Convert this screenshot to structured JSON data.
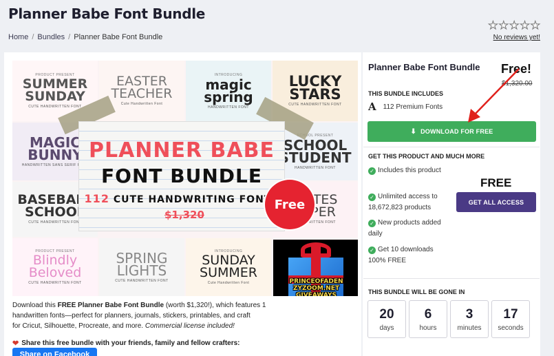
{
  "page": {
    "title": "Planner Babe Font Bundle",
    "breadcrumb": [
      "Home",
      "Bundles",
      "Planner Babe Font Bundle"
    ],
    "rating": {
      "stars": 0,
      "max_stars": 5,
      "no_reviews_text": "No reviews yet!"
    }
  },
  "product_image": {
    "tiles": [
      {
        "top": "PRODUCT PRESENT",
        "main": "SUMMER SUNDAY",
        "sub": "CUTE HANDWRITTEN FONT",
        "color": "#555555"
      },
      {
        "top": "",
        "main": "EASTER TEACHER",
        "sub": "Cute Handwritten Font",
        "color": "#666666"
      },
      {
        "top": "INTRODUCING",
        "main": "magic spring",
        "sub": "HANDWRITTEN FONT",
        "color": "#222222"
      },
      {
        "top": "",
        "main": "LUCKY STARS",
        "sub": "CUTE HANDWRITTEN FONT",
        "color": "#222222"
      },
      {
        "top": "",
        "main": "MAGIC BUNNY",
        "sub": "HANDWRITTEN SANS SERIF FONT",
        "color": "#5b4a6e"
      },
      {
        "top": "SCHOOL PRESENT",
        "main": "SCHOOL STUDENT",
        "sub": "HANDWRITTEN FONT",
        "color": "#333333"
      },
      {
        "top": "",
        "main": "BASEBALL SCHOOL",
        "sub": "CUTE HANDWRITTEN FONT",
        "color": "#333333"
      },
      {
        "top": "",
        "main": "NOTES PAPER",
        "sub": "HANDWRITTEN FONT",
        "color": "#444444"
      },
      {
        "top": "PRODUCT PRESENT",
        "main": "Blindly Beloved",
        "sub": "CUTE HANDWRITTEN FONT",
        "color": "#e58cc8"
      },
      {
        "top": "",
        "main": "SPRING LIGHTS",
        "sub": "CUTE HANDWRITTEN FONT",
        "color": "#888888"
      },
      {
        "top": "INTRODUCING",
        "main": "SUNDAY SUMMER",
        "sub": "Cute Handwritten Font",
        "color": "#222222"
      }
    ],
    "hero_title": "PLANNER BABE",
    "hero_subtitle": "FONT BUNDLE",
    "hero_count": "112",
    "hero_count_text": "CUTE HANDWRITING FONTS",
    "hero_price": "$1,320",
    "free_badge": "Free",
    "gift_text": "PRINCEOFADEN ZYZOOM.NET GIVEAWAYS"
  },
  "description": {
    "intro": "Download this ",
    "bold_name": "FREE Planner Babe Font Bundle",
    "rest": " (worth $1,320!), which features 1",
    "line2": "handwritten fonts—perfect for planners, journals, stickers, printables, and craft",
    "line3": "for Cricut, Silhouette, Procreate, and more. ",
    "license": "Commercial license included!",
    "share_text": "Share this free bundle with your friends, family and fellow crafters:",
    "share_button": "Share on Facebook"
  },
  "sidebar": {
    "title": "Planner Babe Font Bundle",
    "overlay_free": "Free!",
    "old_price": "$1,320.00",
    "includes_heading": "THIS BUNDLE INCLUDES",
    "includes_icon": "A",
    "includes_text": "112 Premium Fonts",
    "download_button": "DOWNLOAD FOR FREE",
    "more_heading": "GET THIS PRODUCT AND MUCH MORE",
    "features": [
      "Includes this product",
      "Unlimited access to 18,672,823 products",
      "New products added daily",
      "Get 10 downloads 100% FREE"
    ],
    "access_price": "FREE",
    "access_button": "GET ALL ACCESS",
    "gone_heading": "THIS BUNDLE WILL BE GONE IN",
    "countdown": [
      {
        "value": "20",
        "label": "days"
      },
      {
        "value": "6",
        "label": "hours"
      },
      {
        "value": "3",
        "label": "minutes"
      },
      {
        "value": "17",
        "label": "seconds"
      }
    ],
    "accent_green": "#3fad5c",
    "accent_purple": "#4a3a85"
  }
}
